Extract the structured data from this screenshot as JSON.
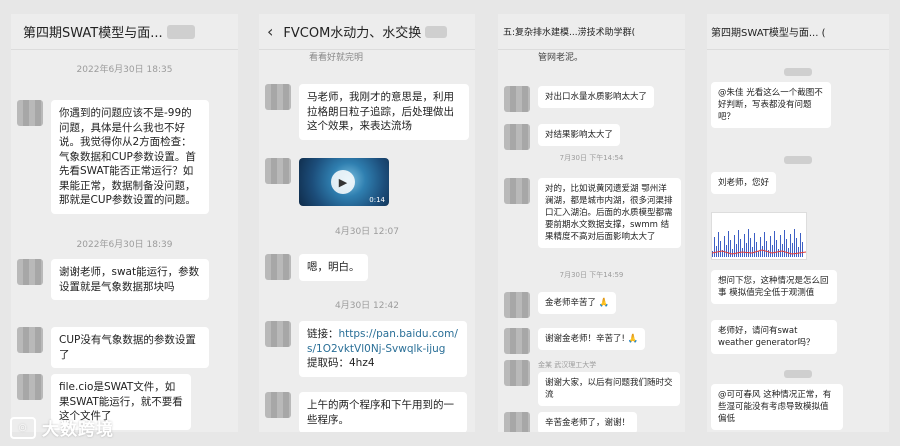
{
  "panel1": {
    "title": "第四期SWAT模型与面...",
    "ts1": "2022年6月30日 18:35",
    "msg1": "你遇到的问题应该不是-99的问题，具体是什么我也不好说。我觉得你从2方面检查：气象数据和CUP参数设置。首先看SWAT能否正常运行？如果能正常，数据制备没问题，那就是CUP参数设置的问题。",
    "ts2": "2022年6月30日 18:39",
    "msg2": "谢谢老师，swat能运行，参数设置就是气象数据那块吗",
    "msg3": "CUP没有气象数据的参数设置了",
    "msg4": "file.cio是SWAT文件，如果SWAT能运行，就不要看这个文件了"
  },
  "panel2": {
    "title": "FVCOM水动力、水交换",
    "top_fragment": "看看好就完明",
    "msg1": "马老师，我刚才的意思是，利用拉格朗日粒子追踪，后处理做出这个效果，来表达流场",
    "video_duration": "0:14",
    "ts1": "4月30日 12:07",
    "msg2": "嗯，明白。",
    "ts2": "4月30日 12:42",
    "link_prefix": "链接：",
    "link_url": "https://pan.baidu.com/s/1O2vktVl0Nj-Svwqlk-ijug",
    "code_label": "提取码：",
    "code_value": "4hz4",
    "msg4": "上午的两个程序和下午用到的一些程序。"
  },
  "panel3": {
    "title": "五:复杂排水建模...涝技术助学群(",
    "top_fragment": "管网老泥。",
    "msg1": "对出口水量水质影响太大了",
    "msg2": "对结果影响太大了",
    "ts1": "7月30日 下午14:54",
    "msg3": "对的，比如说黄冈遗爱湖 鄂州洋澜湖，都是城市内湖，很多河渠排口汇入湖泊。后面的水质模型都需要前期水文数据支撑，swmm 结果精度不高对后面影响太大了",
    "ts2": "7月30日 下午14:59",
    "msg4": "金老师辛苦了",
    "msg5": "谢谢金老师！辛苦了!",
    "sender6": "金某 武汉理工大学",
    "msg6": "谢谢大家，以后有问题我们随时交流",
    "msg7": "辛苦金老师了，谢谢！"
  },
  "panel4": {
    "title": "第四期SWAT模型与面... (",
    "msg1": "@朱佳 光看这么一个截图不好判断，写表都没有问题吧？",
    "msg2": "刘老师，您好",
    "msg3": "想问下您，这种情况是怎么回事 模拟值完全低于观测值",
    "msg4": "老师好，请问有swat weather generator吗？",
    "msg5": "@可可春风 这种情况正常，有些湿可能没有考虑导致模拟值偏低"
  },
  "watermark": "大数跨境"
}
